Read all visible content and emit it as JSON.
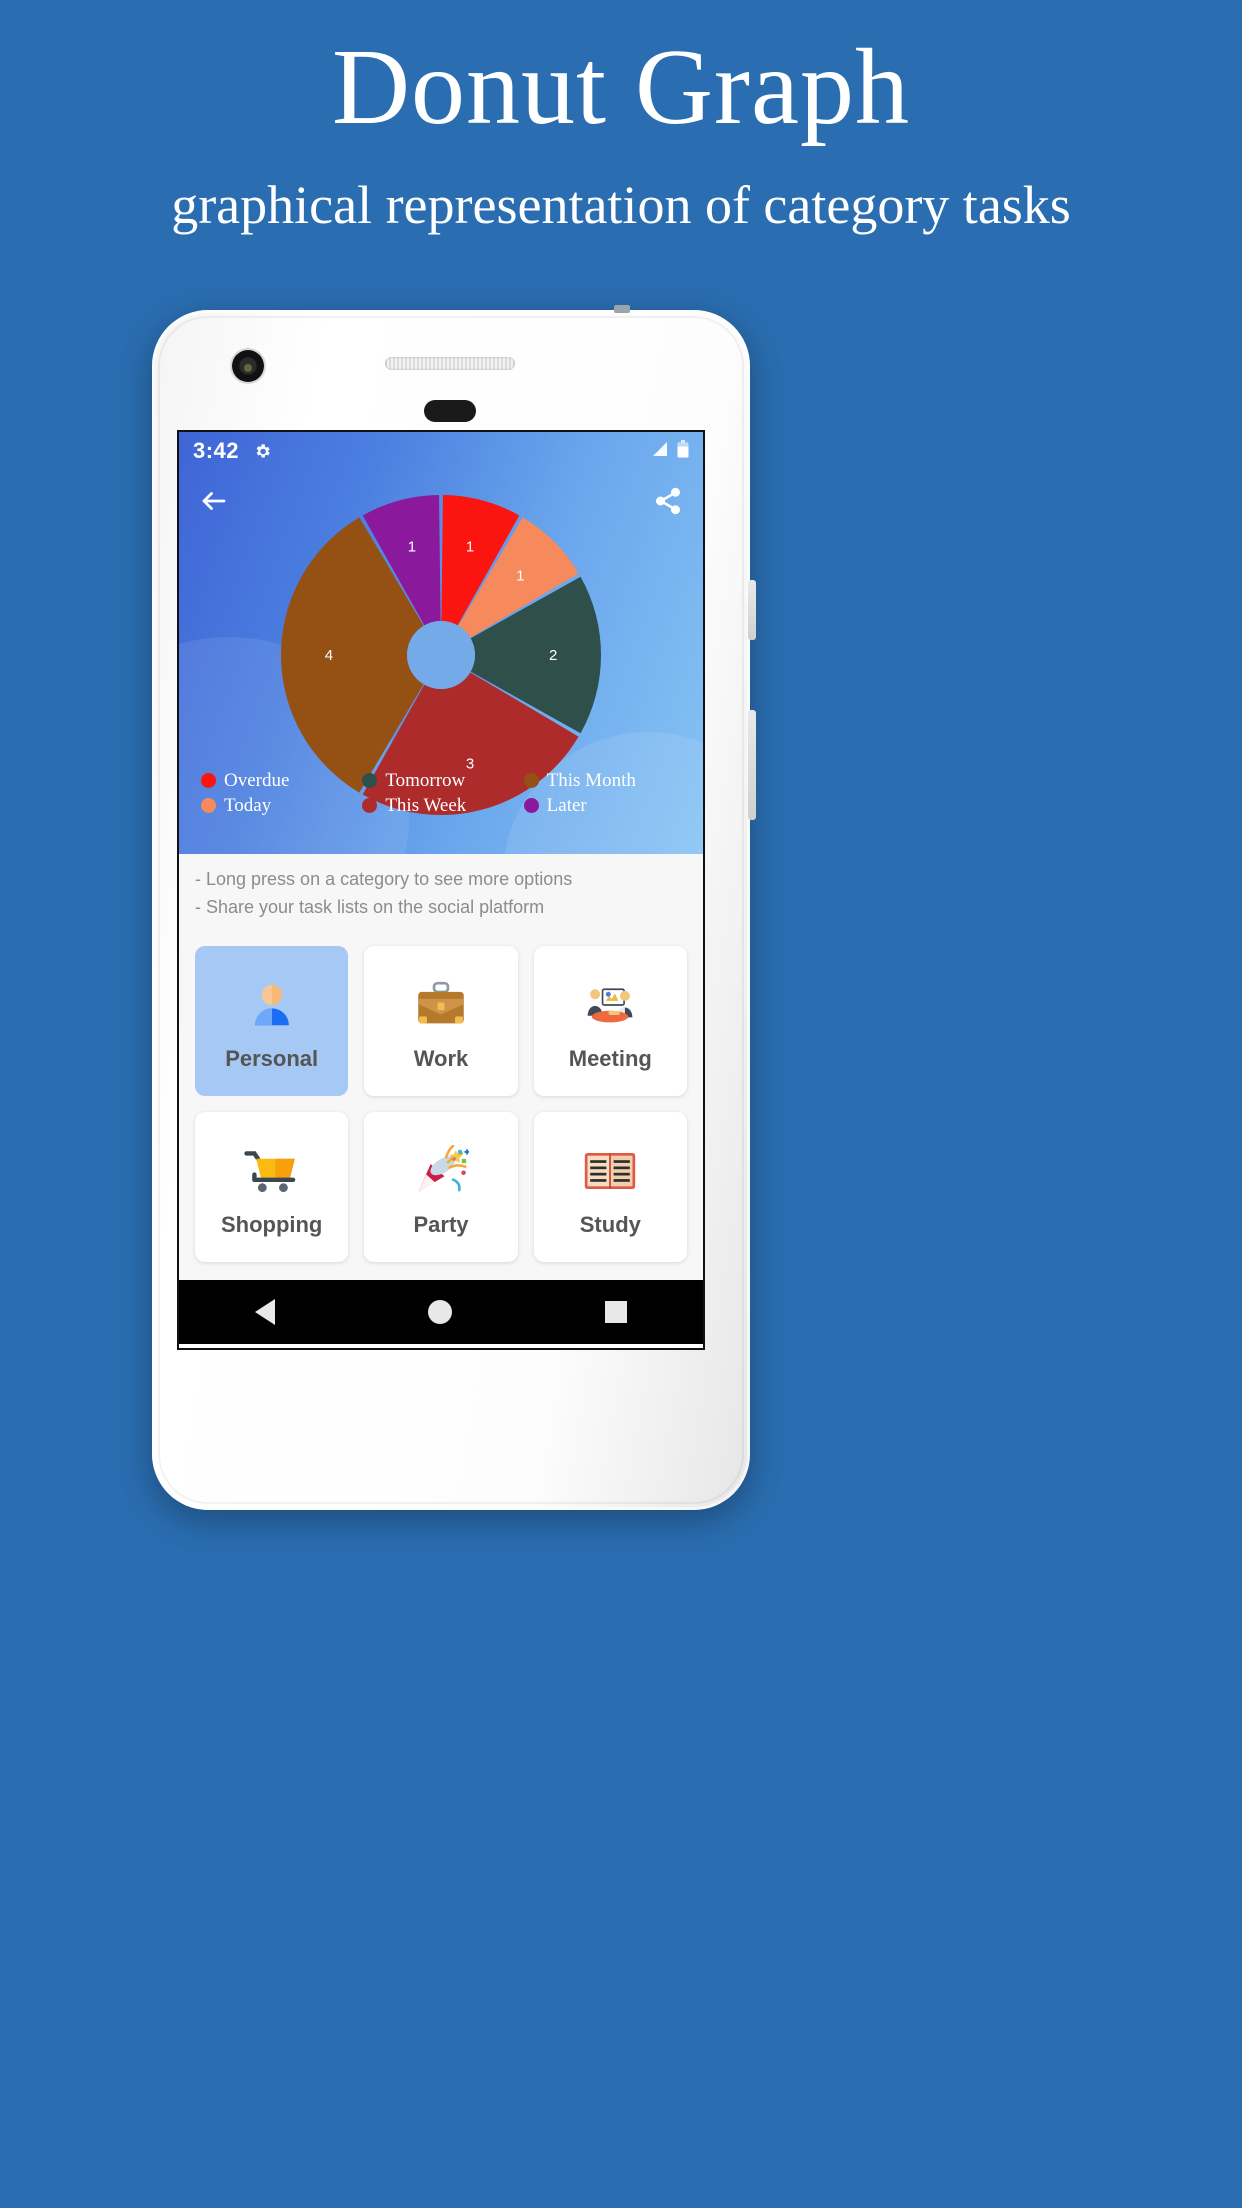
{
  "hero": {
    "title": "Donut Graph",
    "subtitle": "graphical representation of category tasks",
    "background_color": "#2a6db0"
  },
  "status_bar": {
    "time": "3:42",
    "gear_icon": "gear-icon",
    "signal_icon": "signal-icon",
    "battery_icon": "battery-icon"
  },
  "app_bar": {
    "back_icon": "back-arrow-icon",
    "share_icon": "share-icon"
  },
  "chart_data": {
    "type": "pie",
    "title": "",
    "subtitle": "",
    "xlabel": "",
    "ylabel": "",
    "legend_position": "bottom",
    "grid": false,
    "donut_hole": true,
    "total": 12,
    "categories": [
      "Overdue",
      "Today",
      "Tomorrow",
      "This Week",
      "This Month",
      "Later"
    ],
    "values": [
      1,
      1,
      2,
      3,
      4,
      1
    ],
    "colors": [
      "#fb1410",
      "#f78a5c",
      "#2f4f4a",
      "#ad2b2b",
      "#955014",
      "#8a1a9b"
    ],
    "slices": [
      {
        "label": "Overdue",
        "value": 1,
        "value_text": "1",
        "color": "#fb1410"
      },
      {
        "label": "Today",
        "value": 1,
        "value_text": "1",
        "color": "#f78a5c"
      },
      {
        "label": "Tomorrow",
        "value": 2,
        "value_text": "2",
        "color": "#2f4f4a"
      },
      {
        "label": "This Week",
        "value": 3,
        "value_text": "3",
        "color": "#ad2b2b"
      },
      {
        "label": "This Month",
        "value": 4,
        "value_text": "4",
        "color": "#955014"
      },
      {
        "label": "Later",
        "value": 1,
        "value_text": "1",
        "color": "#8a1a9b"
      }
    ],
    "legend": [
      {
        "label": "Overdue",
        "color": "#fb1410"
      },
      {
        "label": "Tomorrow",
        "color": "#2f4f4a"
      },
      {
        "label": "This Month",
        "color": "#955014"
      },
      {
        "label": "Today",
        "color": "#f78a5c"
      },
      {
        "label": "This Week",
        "color": "#ad2b2b"
      },
      {
        "label": "Later",
        "color": "#8a1a9b"
      }
    ]
  },
  "hints": {
    "line1": "- Long press on a category to see more options",
    "line2": "- Share your task lists on the social platform"
  },
  "categories": [
    {
      "label": "Personal",
      "icon": "person-icon",
      "selected": true
    },
    {
      "label": "Work",
      "icon": "briefcase-icon",
      "selected": false
    },
    {
      "label": "Meeting",
      "icon": "meeting-icon",
      "selected": false
    },
    {
      "label": "Shopping",
      "icon": "cart-icon",
      "selected": false
    },
    {
      "label": "Party",
      "icon": "party-popper-icon",
      "selected": false
    },
    {
      "label": "Study",
      "icon": "open-book-icon",
      "selected": false
    }
  ],
  "nav_bar": {
    "back_label": "back-triangle-icon",
    "home_label": "home-circle-icon",
    "recents_label": "recents-square-icon"
  },
  "selected_card_color": "#a5c8f5"
}
